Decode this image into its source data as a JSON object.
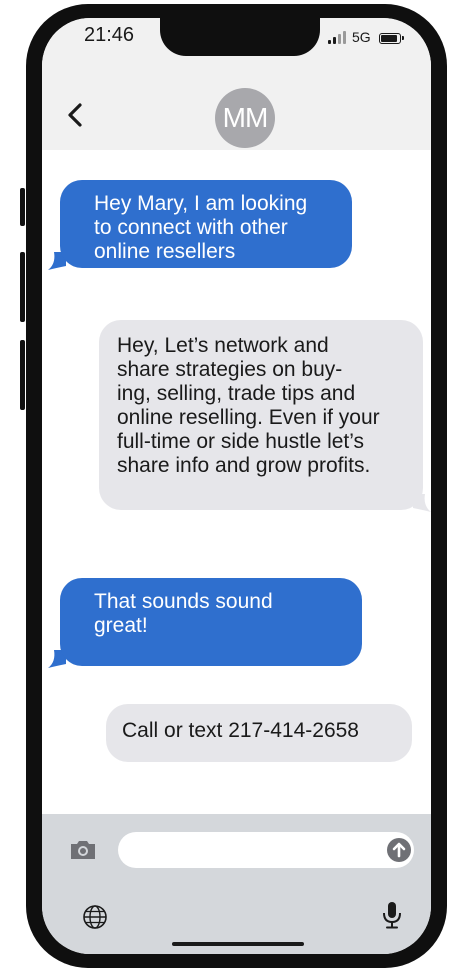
{
  "status_bar": {
    "time": "21:46",
    "network": "5G"
  },
  "contact": {
    "initials": "MM"
  },
  "messages": [
    {
      "direction": "outgoing",
      "lines": [
        "Hey Mary, I am looking",
        "to connect with other",
        "online resellers"
      ]
    },
    {
      "direction": "incoming",
      "lines": [
        "Hey, Let’s network and",
        "share strategies on buy-",
        "ing, selling, trade tips and",
        "online reselling. Even if your",
        "full-time or side hustle let’s",
        "share info and grow profits."
      ]
    },
    {
      "direction": "outgoing",
      "lines": [
        "That sounds sound",
        "great!"
      ]
    },
    {
      "direction": "incoming",
      "lines": [
        "Call or text 217-414-2658"
      ]
    }
  ],
  "composer": {
    "placeholder": ""
  },
  "icons": {
    "back": "chevron-left-icon",
    "camera": "camera-icon",
    "send": "arrow-up-icon",
    "globe": "globe-icon",
    "mic": "microphone-icon"
  },
  "colors": {
    "outgoing_bubble": "#2f6fce",
    "incoming_bubble": "#e6e6ea",
    "header_bg": "#f1f1f1",
    "composer_bg": "#d4d7db",
    "avatar_bg": "#a8a8ac"
  }
}
